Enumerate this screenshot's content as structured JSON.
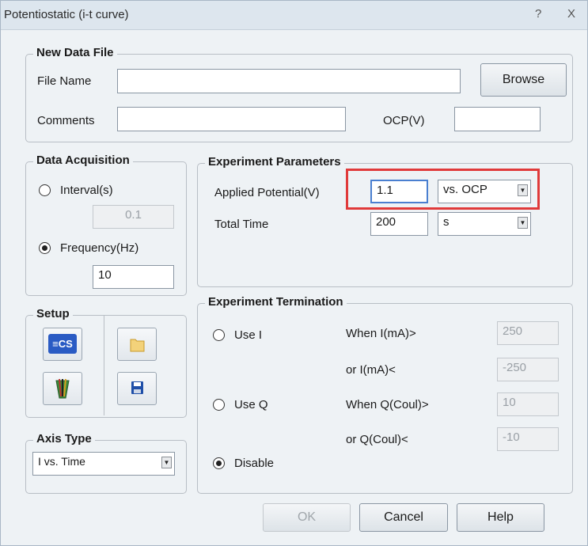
{
  "window": {
    "title": "Potentiostatic (i-t curve)",
    "help_glyph": "?",
    "close_glyph": "X"
  },
  "new_data_file": {
    "legend": "New Data File",
    "file_name_label": "File Name",
    "file_name_value": "",
    "browse_label": "Browse",
    "comments_label": "Comments",
    "comments_value": "",
    "ocp_label": "OCP(V)",
    "ocp_value": ""
  },
  "data_acquisition": {
    "legend": "Data Acquisition",
    "interval_label": "Interval(s)",
    "interval_value": "0.1",
    "frequency_label": "Frequency(Hz)",
    "frequency_value": "10",
    "selected": "frequency"
  },
  "experiment_parameters": {
    "legend": "Experiment Parameters",
    "applied_potential_label": "Applied Potential(V)",
    "applied_potential_value": "1.1",
    "reference_value": "vs. OCP",
    "total_time_label": "Total Time",
    "total_time_value": "200",
    "time_unit_value": "s"
  },
  "setup": {
    "legend": "Setup",
    "cs_icon_text": "≡CS"
  },
  "axis_type": {
    "legend": "Axis Type",
    "value": "I vs. Time"
  },
  "experiment_termination": {
    "legend": "Experiment Termination",
    "use_i_label": "Use I",
    "use_q_label": "Use Q",
    "disable_label": "Disable",
    "selected": "disable",
    "when_i_label": "When I(mA)>",
    "when_i_value": "250",
    "or_i_label": "or I(mA)<",
    "or_i_value": "-250",
    "when_q_label": "When Q(Coul)>",
    "when_q_value": "10",
    "or_q_label": "or Q(Coul)<",
    "or_q_value": "-10"
  },
  "buttons": {
    "ok_label": "OK",
    "cancel_label": "Cancel",
    "help_label": "Help"
  },
  "colors": {
    "highlight": "#e03a3a",
    "window_bg": "#eef2f5",
    "cs_icon": "#2a5bc4"
  }
}
